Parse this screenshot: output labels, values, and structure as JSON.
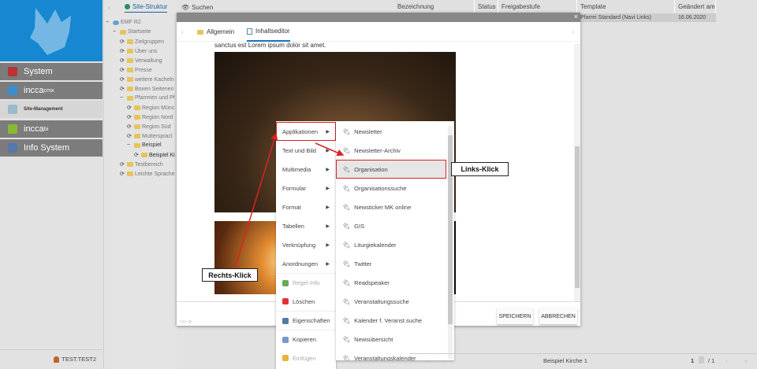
{
  "sidebar": {
    "items": [
      {
        "label": "System",
        "sup": ""
      },
      {
        "label": "incca",
        "sup": "cmx"
      },
      {
        "label": "Site-Management",
        "sup": ""
      },
      {
        "label": "incca",
        "sup": "bi"
      },
      {
        "label": "Info System",
        "sup": ""
      }
    ],
    "user": "TEST.TEST2"
  },
  "tree": {
    "tabs": [
      "Site-Struktur",
      "Suchen"
    ],
    "nodes": [
      "EMF R2",
      "Startseite",
      "Zielgruppen",
      "Über uns",
      "Verwaltung",
      "Presse",
      "weitere Kacheln",
      "Boxen Seitenen",
      "Pfarreien und Pf",
      "Region Münc",
      "Region Nord",
      "Region Süd",
      "Mutterspracl",
      "Beispiel",
      "Beispiel Ki",
      "Testbereich",
      "Leichte Sprache"
    ]
  },
  "table": {
    "columns": [
      "Bezeichnung",
      "Status",
      "Freigabestufe",
      "Template",
      "Geändert am"
    ],
    "row": {
      "template": "Pfarrei Standard (Navi Links)",
      "changed": "16.06.2020"
    }
  },
  "modal": {
    "tabs": [
      "Allgemein",
      "Inhaltseditor"
    ],
    "active_tab": "Inhaltseditor",
    "text": "sanctus est Lorem ipsum dolor sit amet.",
    "save": "SPEICHERN",
    "cancel": "ABBRECHEN"
  },
  "context_menu": {
    "items": [
      "Applikationen",
      "Text und Bild",
      "Multimedia",
      "Formular",
      "Format",
      "Tabellen",
      "Verknüpfung",
      "Anordnungen",
      "Regel-Info",
      "Löschen",
      "Eigenschaften",
      "Kopieren",
      "Einfügen"
    ]
  },
  "submenu": {
    "items": [
      "Newsletter",
      "Newsletter-Archiv",
      "Organisation",
      "Organisationssuche",
      "Newsticker MK online",
      "GIS",
      "Liturgiekalender",
      "Twitter",
      "Readspeaker",
      "Veranstaltungssuche",
      "Kalender f. Veranst.suche",
      "Newsübersicht",
      "Veranstaltungskalender"
    ]
  },
  "annotations": {
    "left_click": "Links-Klick",
    "right_click": "Rechts-Klick"
  },
  "pager": {
    "label": "Beispiel Kirche 1",
    "page": "1",
    "total": "/ 1"
  },
  "colors": {
    "brand": "#1687d0",
    "highlight": "#d22222"
  }
}
